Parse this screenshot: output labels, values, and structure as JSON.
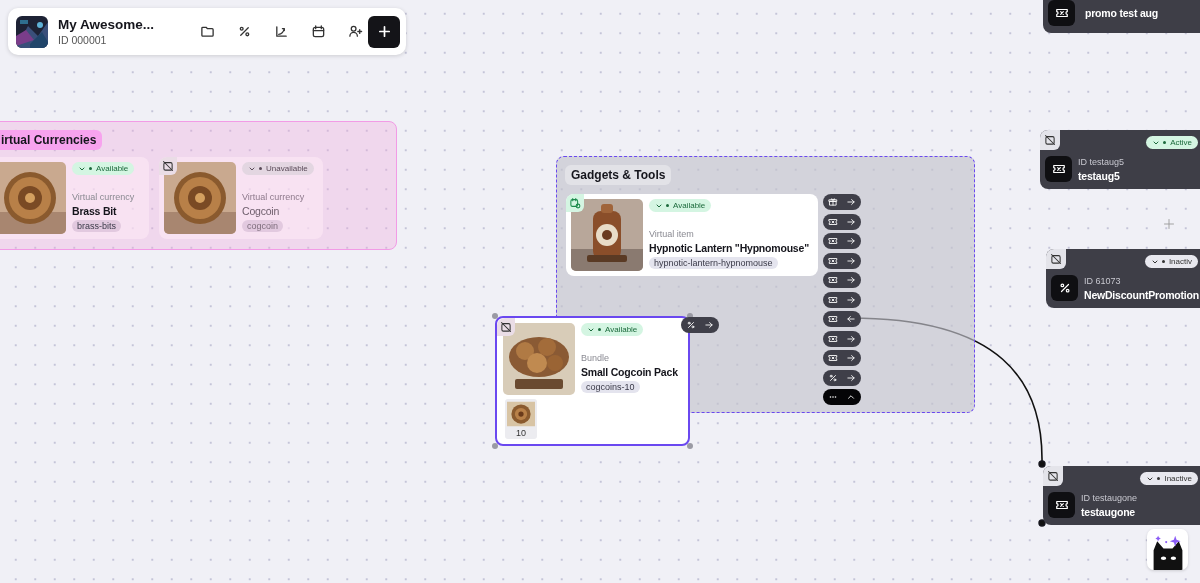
{
  "project": {
    "name": "My Awesome...",
    "id": "ID 000001"
  },
  "groups": [
    {
      "title": "irtual Currencies",
      "kind": "currency",
      "items": [
        {
          "type": "Virtual currency",
          "name": "Brass Bit",
          "slug": "brass-bits",
          "status": "Available",
          "available": true
        },
        {
          "type": "Virtual currency",
          "name": "Cogcoin",
          "slug": "cogcoin",
          "status": "Unavailable",
          "available": false,
          "scheduled": false
        }
      ]
    },
    {
      "title": "Gadgets & Tools",
      "kind": "items",
      "items": [
        {
          "type": "Virtual item",
          "name": "Hypnotic Lantern \"Hypnomouse\"",
          "slug": "hypnotic-lantern-hypnomouse",
          "status": "Available",
          "available": true,
          "scheduled": true,
          "ports": [
            {
              "kind": "gift",
              "inbound": false
            },
            {
              "kind": "coupon",
              "inbound": false
            },
            {
              "kind": "coupon",
              "inbound": false
            },
            {
              "kind": "coupon",
              "inbound": false
            },
            {
              "kind": "coupon",
              "inbound": false
            },
            {
              "kind": "coupon",
              "inbound": false
            },
            {
              "kind": "coupon",
              "inbound": true
            },
            {
              "kind": "coupon",
              "inbound": false
            },
            {
              "kind": "coupon",
              "inbound": false
            },
            {
              "kind": "percent",
              "inbound": false
            },
            {
              "kind": "more",
              "expanded": true
            }
          ]
        }
      ]
    }
  ],
  "bundle": {
    "type": "Bundle",
    "name": "Small Cogcoin Pack",
    "slug": "cogcoins-10",
    "status": "Available",
    "available": true,
    "scheduled": false,
    "selected": true,
    "contents": [
      {
        "quantity": "10"
      }
    ],
    "ports": [
      {
        "kind": "percent",
        "inbound": false
      }
    ]
  },
  "promotions": [
    {
      "name": "promo test aug",
      "kind": "coupon"
    },
    {
      "id": "ID testaug5",
      "name": "testaug5",
      "kind": "coupon",
      "status": "Active",
      "active": true,
      "scheduled": false
    },
    {
      "id": "ID 61073",
      "name": "NewDiscountPromotion",
      "kind": "discount",
      "status": "Inactiv",
      "active": false,
      "scheduled": false
    },
    {
      "id": "ID testaugone",
      "name": "testaugone",
      "kind": "coupon",
      "status": "Inactive",
      "active": false,
      "scheduled": false
    }
  ]
}
